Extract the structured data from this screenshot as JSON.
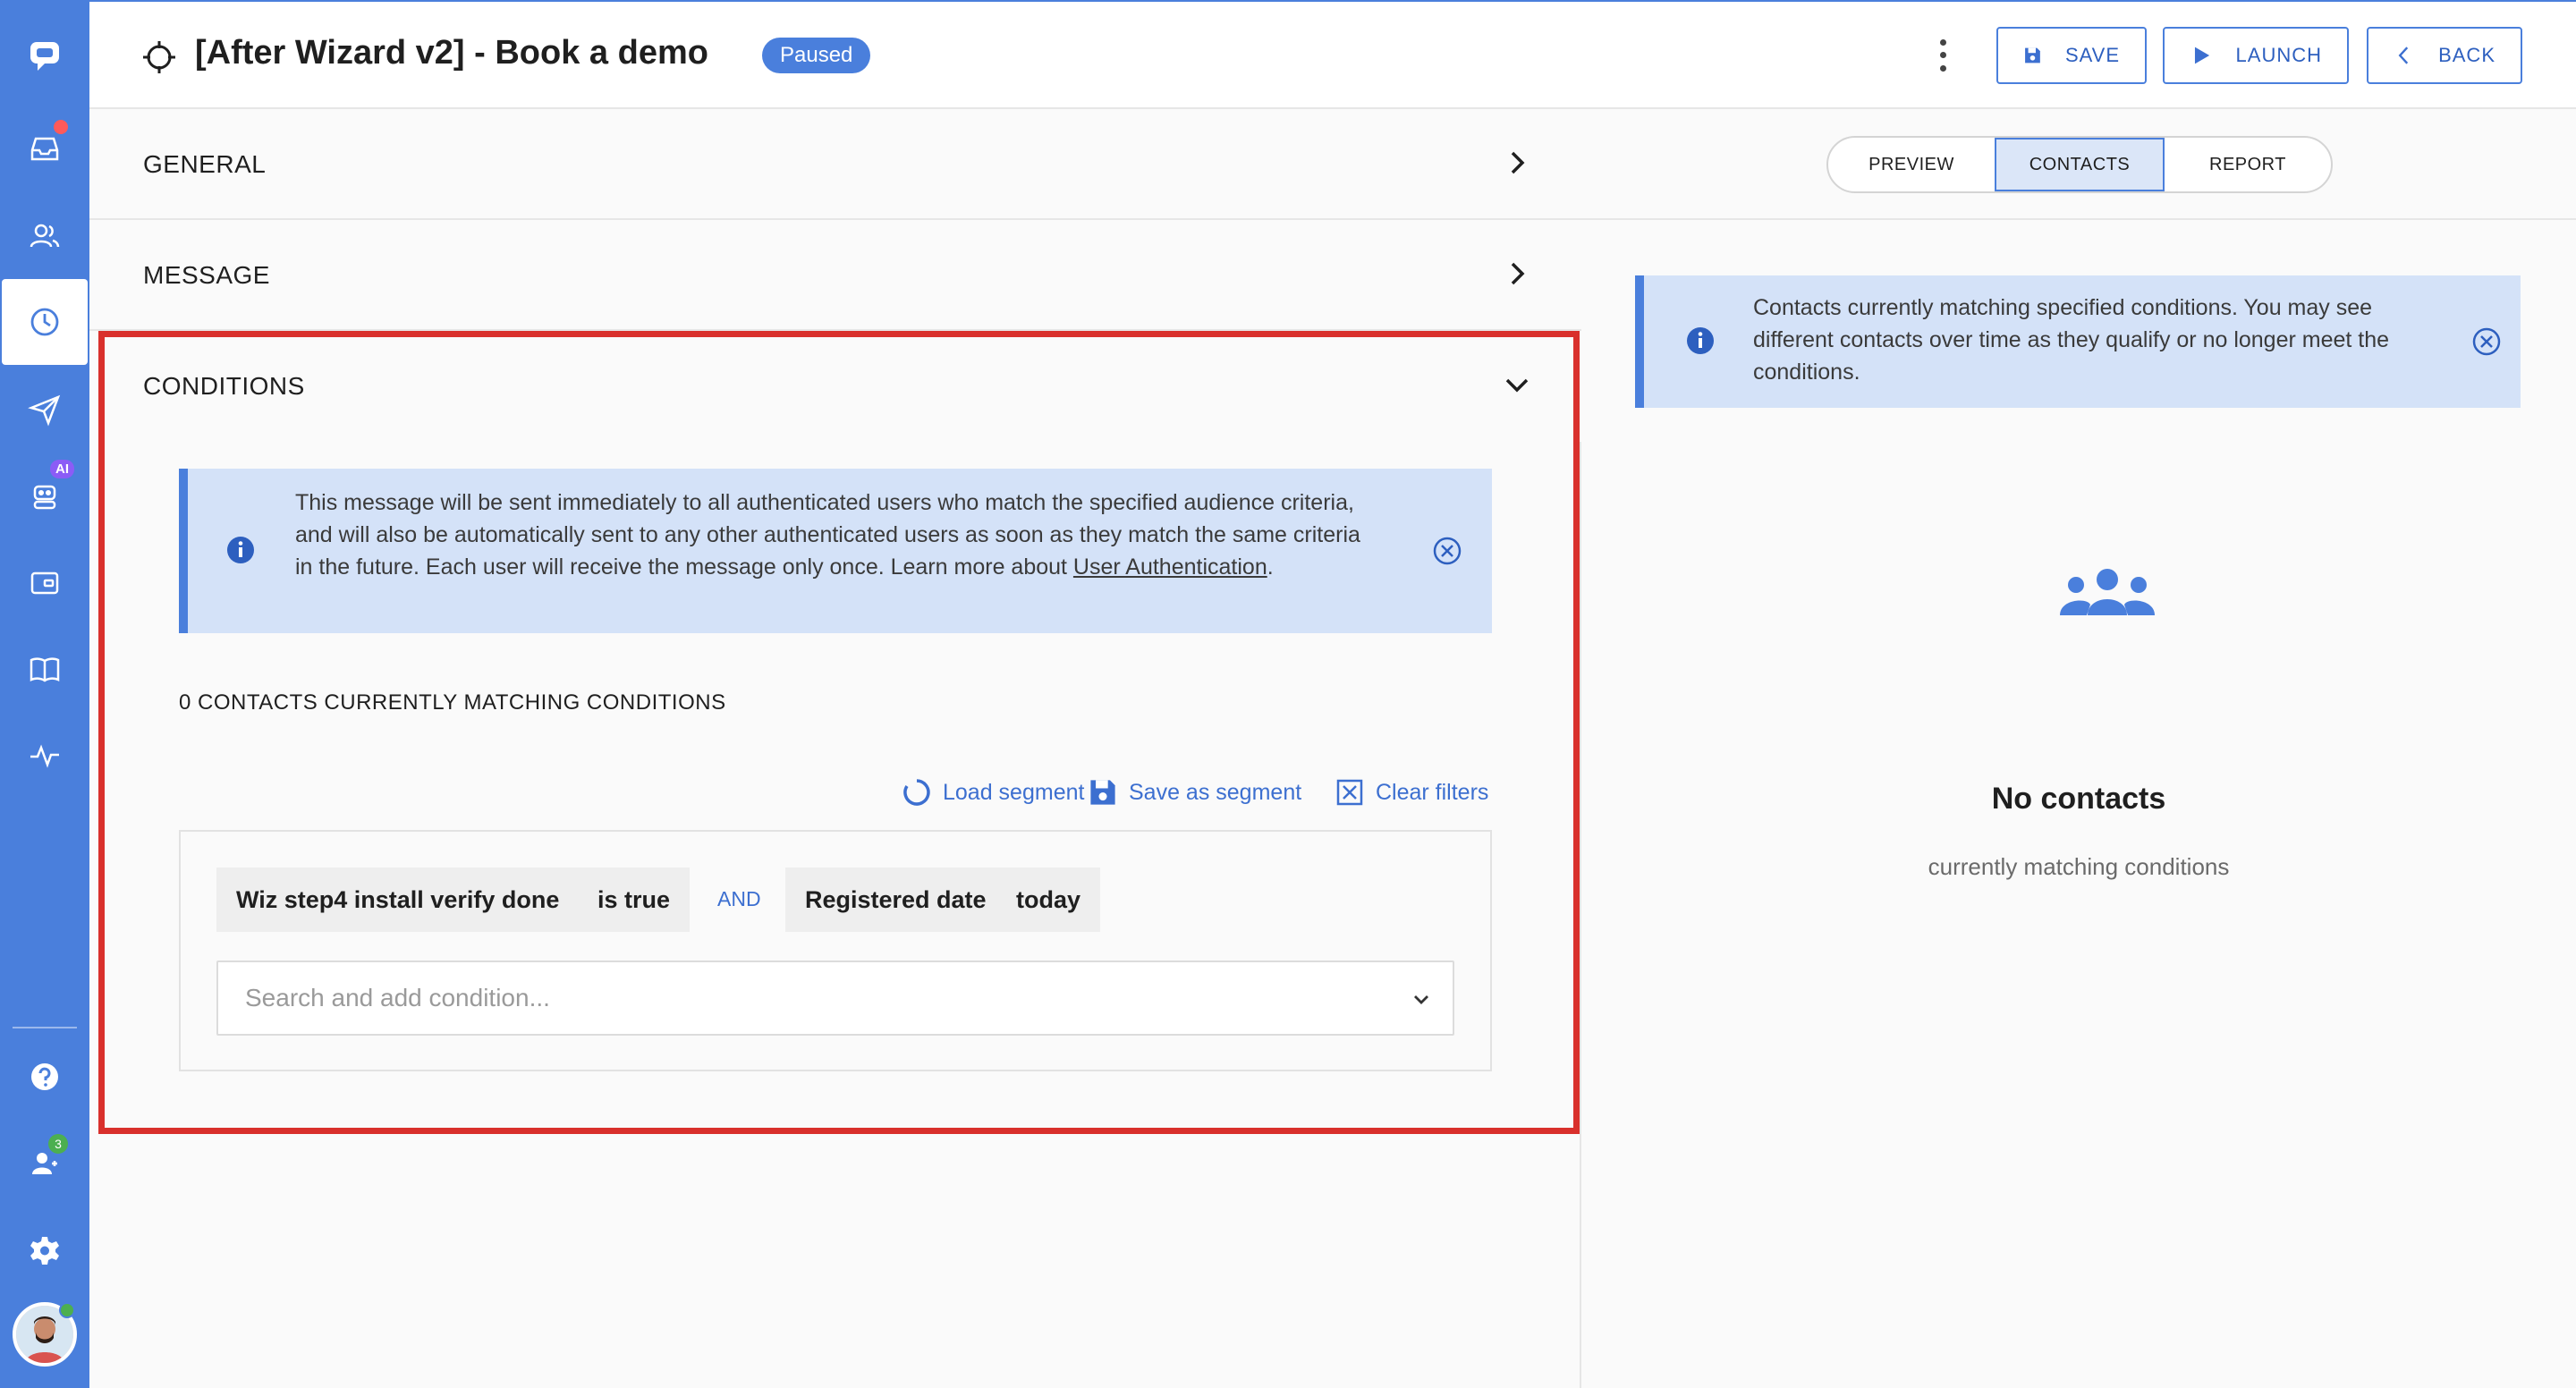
{
  "sidebar": {
    "ai_badge": "AI",
    "team_count": "3"
  },
  "header": {
    "title": "[After Wizard v2] - Book a demo",
    "status": "Paused",
    "save_label": "SAVE",
    "launch_label": "LAUNCH",
    "back_label": "BACK"
  },
  "sections": {
    "general": "GENERAL",
    "message": "MESSAGE",
    "conditions": "CONDITIONS"
  },
  "conditions": {
    "info_text": "This message will be sent immediately to all authenticated users who match the specified audience criteria, and will also be automatically sent to any other authenticated users as soon as they match the same criteria in the future. Each user will receive the message only once. Learn more about ",
    "info_link": "User Authentication",
    "info_end": ".",
    "match_count": "0 CONTACTS CURRENTLY MATCHING CONDITIONS",
    "load_segment": "Load segment",
    "save_segment": "Save as segment",
    "clear_filters": "Clear filters",
    "chips": [
      "Wiz step4 install verify done",
      "is true",
      "Registered date",
      "today"
    ],
    "operator": "AND",
    "search_placeholder": "Search and add condition..."
  },
  "right": {
    "tabs": [
      "PREVIEW",
      "CONTACTS",
      "REPORT"
    ],
    "active_tab": "CONTACTS",
    "info_text": "Contacts currently matching specified conditions. You may see different contacts over time as they qualify or no longer meet the conditions.",
    "empty_title": "No contacts",
    "empty_sub": "currently matching conditions"
  },
  "colors": {
    "accent": "#4a7fdc",
    "highlight": "#d9302c",
    "info_bg": "#d4e2f8"
  }
}
